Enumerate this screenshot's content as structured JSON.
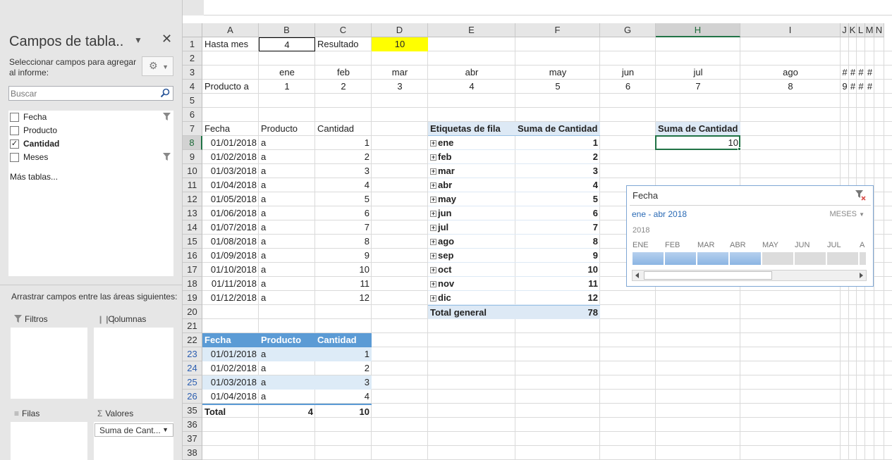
{
  "pane": {
    "title": "Campos de tabla..",
    "subtitle": "Seleccionar campos para agregar al informe:",
    "search_placeholder": "Buscar",
    "fields": [
      {
        "label": "Fecha",
        "checked": false,
        "filtered": true
      },
      {
        "label": "Producto",
        "checked": false,
        "filtered": false
      },
      {
        "label": "Cantidad",
        "checked": true,
        "filtered": false
      },
      {
        "label": "Meses",
        "checked": false,
        "filtered": true
      }
    ],
    "more_tables": "Más tablas...",
    "drag_title": "Arrastrar campos entre las áreas siguientes:",
    "areas": {
      "filters": "Filtros",
      "columns": "Columnas",
      "rows": "Filas",
      "values": "Valores"
    },
    "values_item": "Suma de Cant..."
  },
  "grid": {
    "columns": [
      "A",
      "B",
      "C",
      "D",
      "E",
      "F",
      "G",
      "H",
      "I",
      "J",
      "K",
      "L",
      "M",
      "N"
    ],
    "selected_column": "H",
    "rows": [
      "1",
      "2",
      "3",
      "4",
      "5",
      "6",
      "7",
      "8",
      "9",
      "10",
      "11",
      "12",
      "13",
      "14",
      "15",
      "16",
      "17",
      "18",
      "19",
      "20",
      "21",
      "22",
      "23",
      "24",
      "25",
      "26",
      "35",
      "36",
      "37",
      "38"
    ],
    "selected_row": "8",
    "r1": {
      "a": "Hasta mes",
      "b": "4",
      "c": "Resultado",
      "d": "10"
    },
    "months": [
      "ene",
      "feb",
      "mar",
      "abr",
      "may",
      "jun",
      "jul",
      "ago"
    ],
    "month_hash": "#",
    "product_label": "Producto a",
    "month_numbers": [
      "1",
      "2",
      "3",
      "4",
      "5",
      "6",
      "7",
      "8",
      "9"
    ],
    "source_headers": [
      "Fecha",
      "Producto",
      "Cantidad"
    ],
    "source_rows": [
      [
        "01/01/2018",
        "a",
        "1"
      ],
      [
        "01/02/2018",
        "a",
        "2"
      ],
      [
        "01/03/2018",
        "a",
        "3"
      ],
      [
        "01/04/2018",
        "a",
        "4"
      ],
      [
        "01/05/2018",
        "a",
        "5"
      ],
      [
        "01/06/2018",
        "a",
        "6"
      ],
      [
        "01/07/2018",
        "a",
        "7"
      ],
      [
        "01/08/2018",
        "a",
        "8"
      ],
      [
        "01/09/2018",
        "a",
        "9"
      ],
      [
        "01/10/2018",
        "a",
        "10"
      ],
      [
        "01/11/2018",
        "a",
        "11"
      ],
      [
        "01/12/2018",
        "a",
        "12"
      ]
    ],
    "pivot1": {
      "row_label": "Etiquetas de fila",
      "sum_label": "Suma de Cantidad",
      "rows": [
        [
          "ene",
          "1"
        ],
        [
          "feb",
          "2"
        ],
        [
          "mar",
          "3"
        ],
        [
          "abr",
          "4"
        ],
        [
          "may",
          "5"
        ],
        [
          "jun",
          "6"
        ],
        [
          "jul",
          "7"
        ],
        [
          "ago",
          "8"
        ],
        [
          "sep",
          "9"
        ],
        [
          "oct",
          "10"
        ],
        [
          "nov",
          "11"
        ],
        [
          "dic",
          "12"
        ]
      ],
      "total_label": "Total general",
      "total": "78"
    },
    "pivot2": {
      "header": "Suma de Cantidad",
      "value": "10"
    },
    "table2": {
      "headers": [
        "Fecha",
        "Producto",
        "Cantidad"
      ],
      "rows": [
        [
          "01/01/2018",
          "a",
          "1"
        ],
        [
          "01/02/2018",
          "a",
          "2"
        ],
        [
          "01/03/2018",
          "a",
          "3"
        ],
        [
          "01/04/2018",
          "a",
          "4"
        ]
      ],
      "total_label": "Total",
      "total_count": "4",
      "total_sum": "10"
    }
  },
  "timeline": {
    "title": "Fecha",
    "range": "ene - abr 2018",
    "level": "MESES",
    "year": "2018",
    "months": [
      "ENE",
      "FEB",
      "MAR",
      "ABR",
      "MAY",
      "JUN",
      "JUL",
      "A"
    ],
    "selected_count": 4
  },
  "colors": {
    "highlight_yellow": "#ffff00",
    "excel_green": "#217346",
    "table_blue": "#5b9bd5"
  }
}
